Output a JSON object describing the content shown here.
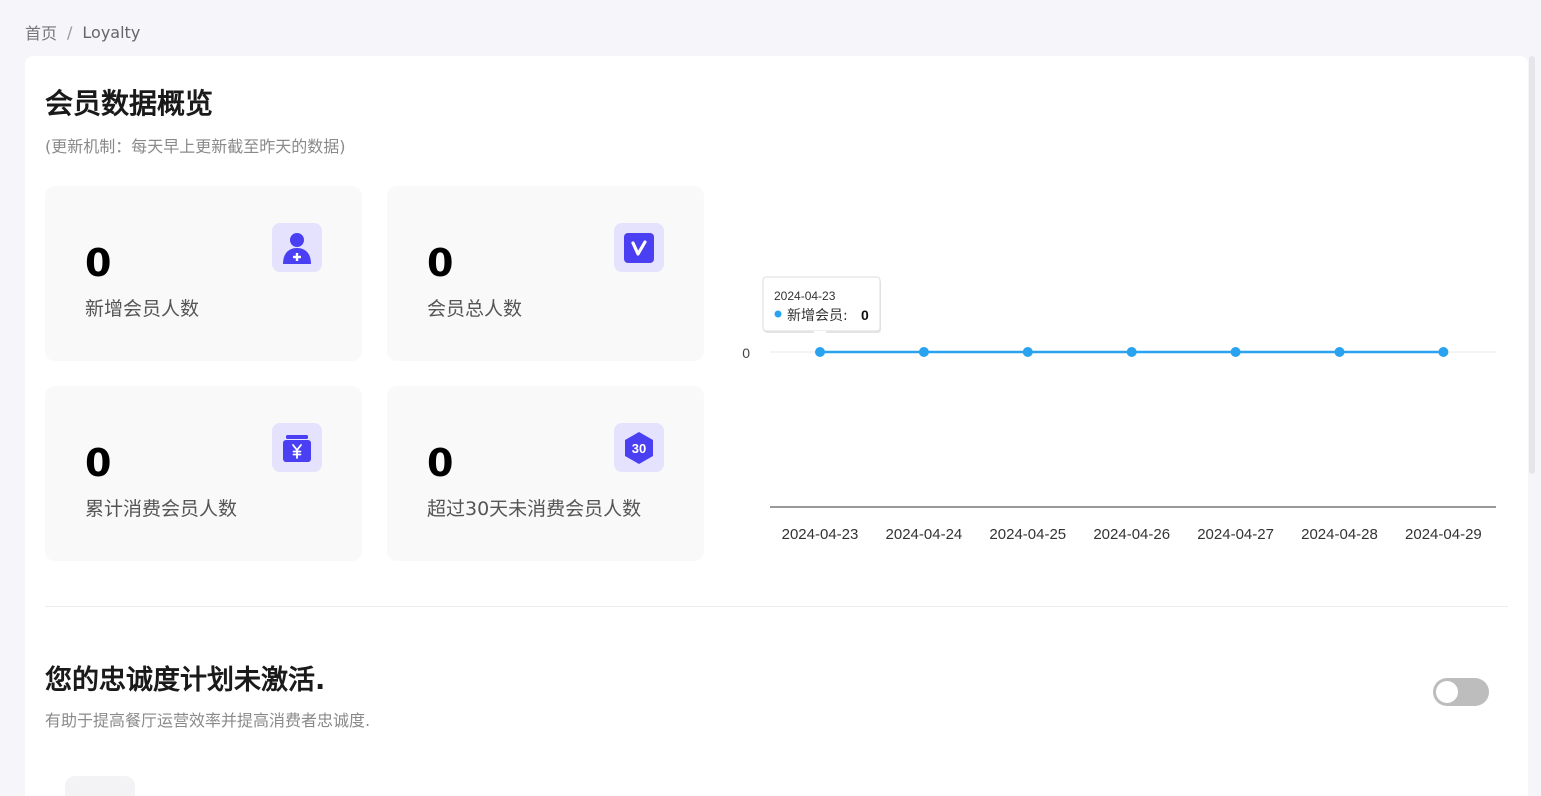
{
  "breadcrumb": {
    "home": "首页",
    "sep": "/",
    "current": "Loyalty"
  },
  "overview": {
    "title": "会员数据概览",
    "subtitle": "(更新机制：每天早上更新截至昨天的数据)",
    "stats": [
      {
        "value": "0",
        "label": "新增会员人数",
        "icon": "add-member-icon"
      },
      {
        "value": "0",
        "label": "会员总人数",
        "icon": "vip-icon"
      },
      {
        "value": "0",
        "label": "累计消费会员人数",
        "icon": "yuan-wallet-icon"
      },
      {
        "value": "0",
        "label": "超过30天未消费会员人数",
        "icon": "thirty-days-icon",
        "icon_text": "30"
      }
    ]
  },
  "chart_data": {
    "type": "line",
    "x": [
      "2024-04-23",
      "2024-04-24",
      "2024-04-25",
      "2024-04-26",
      "2024-04-27",
      "2024-04-28",
      "2024-04-29"
    ],
    "series": [
      {
        "name": "新增会员",
        "values": [
          0,
          0,
          0,
          0,
          0,
          0,
          0
        ],
        "color": "#29a3f0"
      }
    ],
    "y_ticks": [
      "0"
    ],
    "tooltip": {
      "date": "2024-04-23",
      "series": "新增会员",
      "value": "0"
    }
  },
  "loyalty": {
    "title": "您的忠诚度计划未激活.",
    "description": "有助于提高餐厅运营效率并提高消费者忠诚度.",
    "enabled": false
  },
  "colors": {
    "accent": "#4a3ff2",
    "icon_bg": "#e4e2fd",
    "line": "#29a3f0"
  }
}
